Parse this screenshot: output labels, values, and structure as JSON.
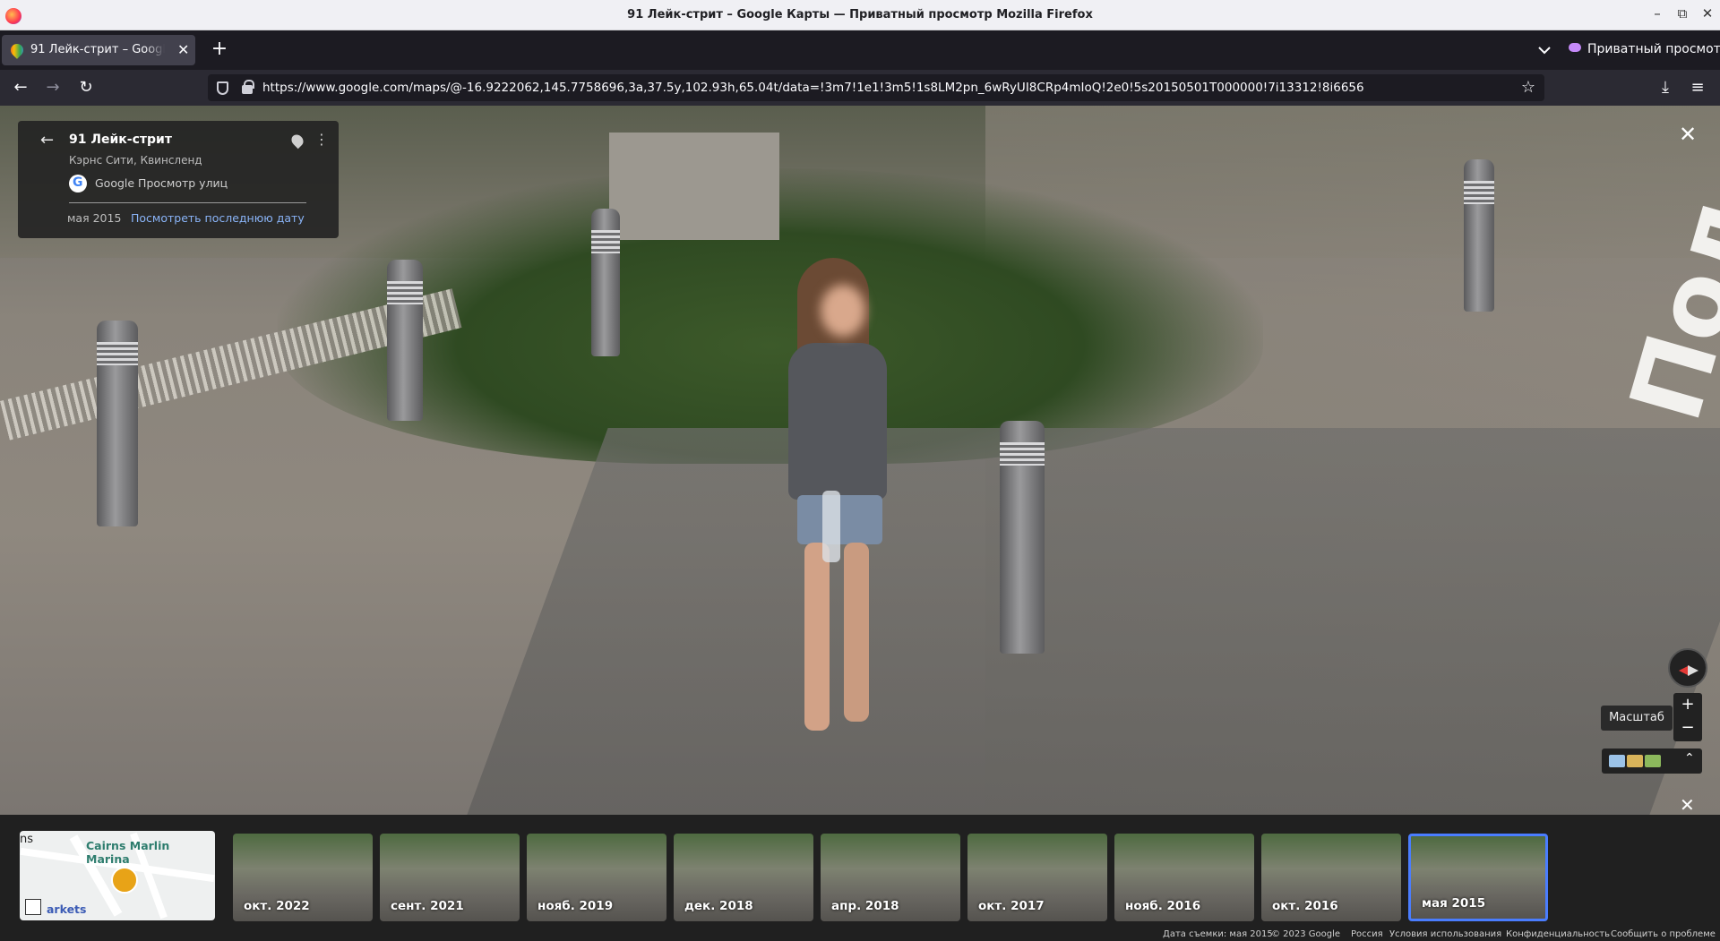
{
  "window": {
    "title": "91 Лейк-стрит – Google Карты — Приватный просмотр Mozilla Firefox",
    "controls": [
      "–",
      "⧉",
      "✕"
    ]
  },
  "tab": {
    "label": "91 Лейк-стрит – Google Карты",
    "close": "✕",
    "new_tab": "+"
  },
  "private_mode": {
    "label": "Приватный просмотр"
  },
  "navbar": {
    "back": "←",
    "forward": "→",
    "reload": "↻",
    "url": "https://www.google.com/maps/@-16.9222062,145.7758696,3a,37.5y,102.93h,65.04t/data=!3m7!1e1!3m5!1s8LM2pn_6wRyUI8CRp4mIoQ!2e0!5s20150501T000000!7i13312!8i6656",
    "bookmark": "☆",
    "downloads": "⤓",
    "menu": "≡"
  },
  "infocard": {
    "back": "←",
    "address": "91 Лейк-стрит",
    "city": "Кэрнс Сити, Квинсленд",
    "source": "Google Просмотр улиц",
    "date": "мая 2015",
    "latest_link": "Посмотреть последнюю дату",
    "more": "⋮"
  },
  "controls": {
    "close": "✕",
    "zoom_in": "+",
    "zoom_out": "−",
    "scale_tooltip": "Масштаб",
    "expand": "⌃",
    "close_strip": "✕"
  },
  "minimap": {
    "partial_label": "ns",
    "marina_label": "Cairns Marlin Marina",
    "markets_label": "arkets"
  },
  "timeline": [
    {
      "label": "окт. 2022",
      "selected": false
    },
    {
      "label": "сент. 2021",
      "selected": false
    },
    {
      "label": "нояб. 2019",
      "selected": false
    },
    {
      "label": "дек. 2018",
      "selected": false
    },
    {
      "label": "апр. 2018",
      "selected": false
    },
    {
      "label": "окт. 2017",
      "selected": false
    },
    {
      "label": "нояб. 2016",
      "selected": false
    },
    {
      "label": "окт. 2016",
      "selected": false
    },
    {
      "label": "мая 2015",
      "selected": true
    }
  ],
  "footer": {
    "capture_date": "Дата съемки: мая 2015",
    "copyright": "© 2023 Google",
    "country": "Россия",
    "terms": "Условия использования",
    "privacy": "Конфиденциальность",
    "report": "Сообщить о проблеме"
  },
  "colors": {
    "accent_link": "#8ab4f8",
    "selected_border": "#4a7dff",
    "private_purple": "#c58af9"
  }
}
